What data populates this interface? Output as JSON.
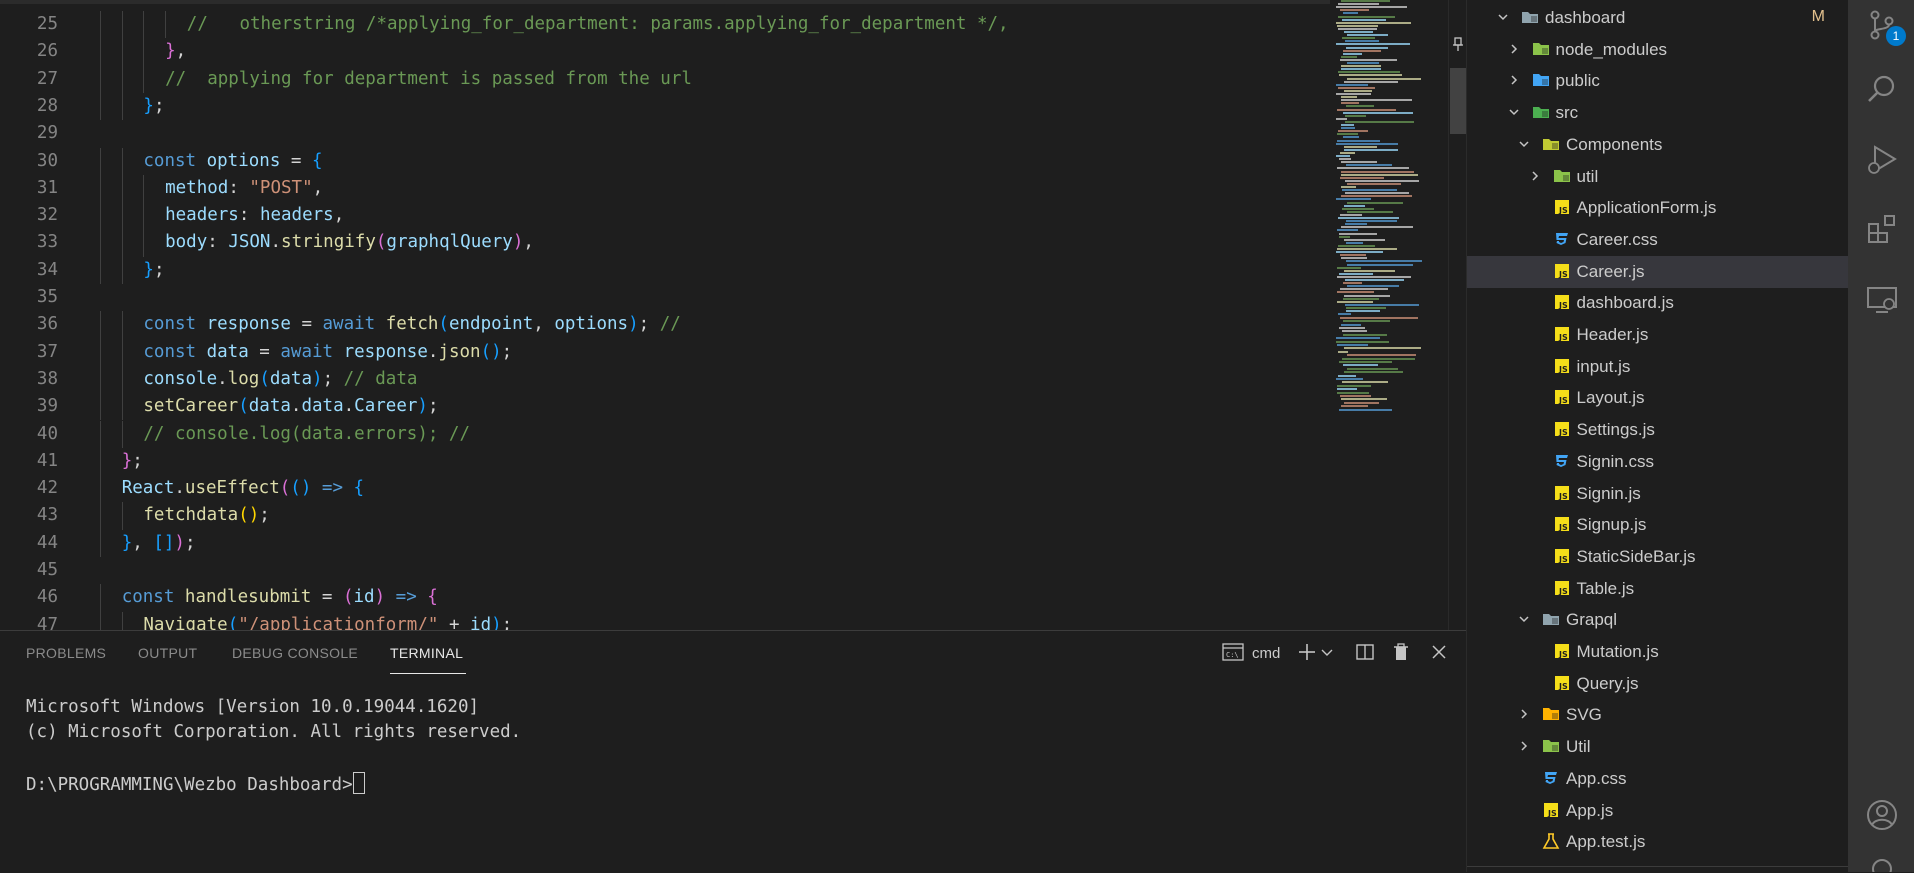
{
  "editor": {
    "lines": [
      {
        "n": "25",
        "indent": 8,
        "tokens": [
          {
            "t": "//   otherstring /*applying_for_department: params.applying_for_department */,",
            "c": "cmt"
          }
        ]
      },
      {
        "n": "26",
        "indent": 7,
        "tokens": [
          {
            "t": "}",
            "c": "p"
          },
          {
            "t": ",",
            "c": "pl"
          }
        ]
      },
      {
        "n": "27",
        "indent": 7,
        "tokens": [
          {
            "t": "//  applying for department is passed from the url",
            "c": "cmt"
          }
        ]
      },
      {
        "n": "28",
        "indent": 6,
        "tokens": [
          {
            "t": "}",
            "c": "b"
          },
          {
            "t": ";",
            "c": "pl"
          }
        ]
      },
      {
        "n": "29",
        "indent": 0,
        "tokens": []
      },
      {
        "n": "30",
        "indent": 6,
        "tokens": [
          {
            "t": "const ",
            "c": "kw"
          },
          {
            "t": "options",
            "c": "var"
          },
          {
            "t": " = ",
            "c": "pl"
          },
          {
            "t": "{",
            "c": "b"
          }
        ]
      },
      {
        "n": "31",
        "indent": 7,
        "tokens": [
          {
            "t": "method",
            "c": "var"
          },
          {
            "t": ": ",
            "c": "pl"
          },
          {
            "t": "\"POST\"",
            "c": "str"
          },
          {
            "t": ",",
            "c": "pl"
          }
        ]
      },
      {
        "n": "32",
        "indent": 7,
        "tokens": [
          {
            "t": "headers",
            "c": "var"
          },
          {
            "t": ": ",
            "c": "pl"
          },
          {
            "t": "headers",
            "c": "var"
          },
          {
            "t": ",",
            "c": "pl"
          }
        ]
      },
      {
        "n": "33",
        "indent": 7,
        "tokens": [
          {
            "t": "body",
            "c": "var"
          },
          {
            "t": ": ",
            "c": "pl"
          },
          {
            "t": "JSON",
            "c": "var"
          },
          {
            "t": ".",
            "c": "pl"
          },
          {
            "t": "stringify",
            "c": "fn"
          },
          {
            "t": "(",
            "c": "p"
          },
          {
            "t": "graphqlQuery",
            "c": "var"
          },
          {
            "t": ")",
            "c": "p"
          },
          {
            "t": ",",
            "c": "pl"
          }
        ]
      },
      {
        "n": "34",
        "indent": 6,
        "tokens": [
          {
            "t": "}",
            "c": "b"
          },
          {
            "t": ";",
            "c": "pl"
          }
        ]
      },
      {
        "n": "35",
        "indent": 0,
        "tokens": []
      },
      {
        "n": "36",
        "indent": 6,
        "tokens": [
          {
            "t": "const ",
            "c": "kw"
          },
          {
            "t": "response",
            "c": "var"
          },
          {
            "t": " = ",
            "c": "pl"
          },
          {
            "t": "await ",
            "c": "kw"
          },
          {
            "t": "fetch",
            "c": "fn"
          },
          {
            "t": "(",
            "c": "b"
          },
          {
            "t": "endpoint",
            "c": "var"
          },
          {
            "t": ", ",
            "c": "pl"
          },
          {
            "t": "options",
            "c": "var"
          },
          {
            "t": ")",
            "c": "b"
          },
          {
            "t": "; ",
            "c": "pl"
          },
          {
            "t": "//",
            "c": "cmt"
          }
        ]
      },
      {
        "n": "37",
        "indent": 6,
        "tokens": [
          {
            "t": "const ",
            "c": "kw"
          },
          {
            "t": "data",
            "c": "var"
          },
          {
            "t": " = ",
            "c": "pl"
          },
          {
            "t": "await ",
            "c": "kw"
          },
          {
            "t": "response",
            "c": "var"
          },
          {
            "t": ".",
            "c": "pl"
          },
          {
            "t": "json",
            "c": "fn"
          },
          {
            "t": "()",
            "c": "b"
          },
          {
            "t": ";",
            "c": "pl"
          }
        ]
      },
      {
        "n": "38",
        "indent": 6,
        "tokens": [
          {
            "t": "console",
            "c": "var"
          },
          {
            "t": ".",
            "c": "pl"
          },
          {
            "t": "log",
            "c": "fn"
          },
          {
            "t": "(",
            "c": "b"
          },
          {
            "t": "data",
            "c": "var"
          },
          {
            "t": ")",
            "c": "b"
          },
          {
            "t": "; ",
            "c": "pl"
          },
          {
            "t": "// data",
            "c": "cmt"
          }
        ]
      },
      {
        "n": "39",
        "indent": 6,
        "tokens": [
          {
            "t": "setCareer",
            "c": "fn"
          },
          {
            "t": "(",
            "c": "b"
          },
          {
            "t": "data",
            "c": "var"
          },
          {
            "t": ".",
            "c": "pl"
          },
          {
            "t": "data",
            "c": "var"
          },
          {
            "t": ".",
            "c": "pl"
          },
          {
            "t": "Career",
            "c": "var"
          },
          {
            "t": ")",
            "c": "b"
          },
          {
            "t": ";",
            "c": "pl"
          }
        ]
      },
      {
        "n": "40",
        "indent": 6,
        "tokens": [
          {
            "t": "// console.log(data.errors); //",
            "c": "cmt"
          }
        ]
      },
      {
        "n": "41",
        "indent": 5,
        "tokens": [
          {
            "t": "}",
            "c": "p"
          },
          {
            "t": ";",
            "c": "pl"
          }
        ]
      },
      {
        "n": "42",
        "indent": 5,
        "tokens": [
          {
            "t": "React",
            "c": "var"
          },
          {
            "t": ".",
            "c": "pl"
          },
          {
            "t": "useEffect",
            "c": "fn"
          },
          {
            "t": "(",
            "c": "p"
          },
          {
            "t": "()",
            "c": "b"
          },
          {
            "t": " => ",
            "c": "kw"
          },
          {
            "t": "{",
            "c": "b"
          }
        ]
      },
      {
        "n": "43",
        "indent": 6,
        "tokens": [
          {
            "t": "fetchdata",
            "c": "fn"
          },
          {
            "t": "()",
            "c": "y"
          },
          {
            "t": ";",
            "c": "pl"
          }
        ]
      },
      {
        "n": "44",
        "indent": 5,
        "tokens": [
          {
            "t": "}",
            "c": "b"
          },
          {
            "t": ", ",
            "c": "pl"
          },
          {
            "t": "[]",
            "c": "b"
          },
          {
            "t": ")",
            "c": "p"
          },
          {
            "t": ";",
            "c": "pl"
          }
        ]
      },
      {
        "n": "45",
        "indent": 0,
        "tokens": []
      },
      {
        "n": "46",
        "indent": 5,
        "tokens": [
          {
            "t": "const ",
            "c": "kw"
          },
          {
            "t": "handlesubmit",
            "c": "fn"
          },
          {
            "t": " = ",
            "c": "pl"
          },
          {
            "t": "(",
            "c": "p"
          },
          {
            "t": "id",
            "c": "var"
          },
          {
            "t": ")",
            "c": "p"
          },
          {
            "t": " => ",
            "c": "kw"
          },
          {
            "t": "{",
            "c": "p"
          }
        ]
      },
      {
        "n": "47",
        "indent": 6,
        "tokens": [
          {
            "t": "Navigate",
            "c": "fn"
          },
          {
            "t": "(",
            "c": "b"
          },
          {
            "t": "\"/applicationform/\"",
            "c": "str"
          },
          {
            "t": " + ",
            "c": "pl"
          },
          {
            "t": "id",
            "c": "var"
          },
          {
            "t": ")",
            "c": "b"
          },
          {
            "t": ";",
            "c": "pl"
          }
        ]
      }
    ]
  },
  "panel": {
    "tabs": [
      "PROBLEMS",
      "OUTPUT",
      "DEBUG CONSOLE",
      "TERMINAL"
    ],
    "active_tab": "TERMINAL",
    "shell_label": "cmd",
    "terminal_lines": [
      "Microsoft Windows [Version 10.0.19044.1620]",
      "(c) Microsoft Corporation. All rights reserved.",
      "",
      "D:\\PROGRAMMING\\Wezbo Dashboard>"
    ]
  },
  "explorer": {
    "items": [
      {
        "label": "dashboard",
        "depth": 0,
        "kind": "folder",
        "open": true,
        "icon": "folder-icon",
        "color": "#90a4ae",
        "modified": "M"
      },
      {
        "label": "node_modules",
        "depth": 1,
        "kind": "folder",
        "open": false,
        "icon": "node-folder-icon",
        "color": "#8bc34a"
      },
      {
        "label": "public",
        "depth": 1,
        "kind": "folder",
        "open": false,
        "icon": "public-folder-icon",
        "color": "#42a5f5"
      },
      {
        "label": "src",
        "depth": 1,
        "kind": "folder",
        "open": true,
        "icon": "src-folder-icon",
        "color": "#4caf50"
      },
      {
        "label": "Components",
        "depth": 2,
        "kind": "folder",
        "open": true,
        "icon": "components-folder-icon",
        "color": "#c0ca33"
      },
      {
        "label": "util",
        "depth": 3,
        "kind": "folder",
        "open": false,
        "icon": "util-folder-icon",
        "color": "#8bc34a"
      },
      {
        "label": "ApplicationForm.js",
        "depth": 3,
        "kind": "js",
        "icon": "js-file-icon",
        "color": "#f5de19"
      },
      {
        "label": "Career.css",
        "depth": 3,
        "kind": "css",
        "icon": "css-file-icon",
        "color": "#42a5f5"
      },
      {
        "label": "Career.js",
        "depth": 3,
        "kind": "js",
        "icon": "js-file-icon",
        "color": "#f5de19",
        "selected": true
      },
      {
        "label": "dashboard.js",
        "depth": 3,
        "kind": "js",
        "icon": "js-file-icon",
        "color": "#f5de19"
      },
      {
        "label": "Header.js",
        "depth": 3,
        "kind": "js",
        "icon": "js-file-icon",
        "color": "#f5de19"
      },
      {
        "label": "input.js",
        "depth": 3,
        "kind": "js",
        "icon": "js-file-icon",
        "color": "#f5de19"
      },
      {
        "label": "Layout.js",
        "depth": 3,
        "kind": "js",
        "icon": "js-file-icon",
        "color": "#f5de19"
      },
      {
        "label": "Settings.js",
        "depth": 3,
        "kind": "js",
        "icon": "js-file-icon",
        "color": "#f5de19"
      },
      {
        "label": "Signin.css",
        "depth": 3,
        "kind": "css",
        "icon": "css-file-icon",
        "color": "#42a5f5"
      },
      {
        "label": "Signin.js",
        "depth": 3,
        "kind": "js",
        "icon": "js-file-icon",
        "color": "#f5de19"
      },
      {
        "label": "Signup.js",
        "depth": 3,
        "kind": "js",
        "icon": "js-file-icon",
        "color": "#f5de19"
      },
      {
        "label": "StaticSideBar.js",
        "depth": 3,
        "kind": "js",
        "icon": "js-file-icon",
        "color": "#f5de19"
      },
      {
        "label": "Table.js",
        "depth": 3,
        "kind": "js",
        "icon": "js-file-icon",
        "color": "#f5de19"
      },
      {
        "label": "Grapql",
        "depth": 2,
        "kind": "folder",
        "open": true,
        "icon": "folder-icon",
        "color": "#90a4ae"
      },
      {
        "label": "Mutation.js",
        "depth": 3,
        "kind": "js",
        "icon": "js-file-icon",
        "color": "#f5de19"
      },
      {
        "label": "Query.js",
        "depth": 3,
        "kind": "js",
        "icon": "js-file-icon",
        "color": "#f5de19"
      },
      {
        "label": "SVG",
        "depth": 2,
        "kind": "folder",
        "open": false,
        "icon": "svg-folder-icon",
        "color": "#ffb300"
      },
      {
        "label": "Util",
        "depth": 2,
        "kind": "folder",
        "open": false,
        "icon": "util-folder-icon",
        "color": "#8bc34a"
      },
      {
        "label": "App.css",
        "depth": 2,
        "kind": "css",
        "icon": "css-file-icon",
        "color": "#42a5f5"
      },
      {
        "label": "App.js",
        "depth": 2,
        "kind": "js",
        "icon": "js-file-icon",
        "color": "#f5de19"
      },
      {
        "label": "App.test.js",
        "depth": 2,
        "kind": "test",
        "icon": "test-flask-icon",
        "color": "#ffca28"
      }
    ]
  },
  "activity_bar": {
    "source_control_badge": "1",
    "buttons": [
      "source-control-icon",
      "search-icon",
      "run-debug-icon",
      "extensions-icon",
      "remote-explorer-icon",
      "accounts-icon"
    ]
  },
  "colors": {
    "editor_bg": "#1e1e1e",
    "activity_bg": "#333333",
    "selected_row": "#37373d",
    "accent": "#007acc",
    "modified": "#e2c08d"
  }
}
